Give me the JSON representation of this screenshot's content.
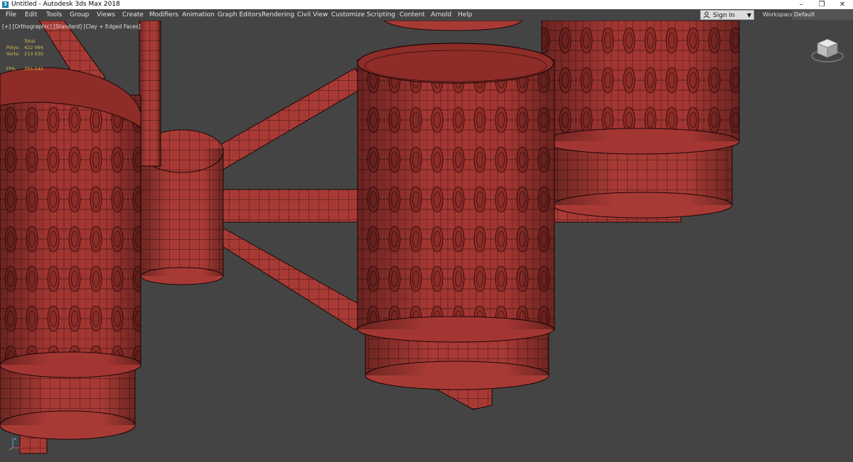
{
  "window": {
    "title": "Untitled - Autodesk 3ds Max 2018",
    "app_icon_glyph": "3",
    "minimize_glyph": "–",
    "restore_glyph": "❐",
    "close_glyph": "✕"
  },
  "menu": {
    "items": [
      "File",
      "Edit",
      "Tools",
      "Group",
      "Views",
      "Create",
      "Modifiers",
      "Animation",
      "Graph Editors",
      "Rendering",
      "Civil View",
      "Customize",
      "Scripting",
      "Content",
      "Arnold",
      "Help"
    ]
  },
  "account": {
    "signin_label": "Sign In",
    "signin_icon": "user-icon"
  },
  "workspaces": {
    "label": "Workspaces:",
    "selected": "Default"
  },
  "viewport": {
    "label": "[+] [Orthographic] [Standard] [Clay + Edged Faces]",
    "stats": {
      "total_label": "Total",
      "polys_label": "Polys:",
      "polys_value": "422 064",
      "verts_label": "Verts:",
      "verts_value": "213 035",
      "fps_label": "FPS:",
      "fps_value": "355.542"
    },
    "viewcube_icon": "viewcube-icon",
    "axis_icon": "axis-tripod-icon"
  },
  "colors": {
    "clay": "#a83a35",
    "clay_dark": "#7e2623",
    "wire": "#1b0706",
    "viewport_bg": "#444444",
    "stats_text": "#d8c04a"
  }
}
